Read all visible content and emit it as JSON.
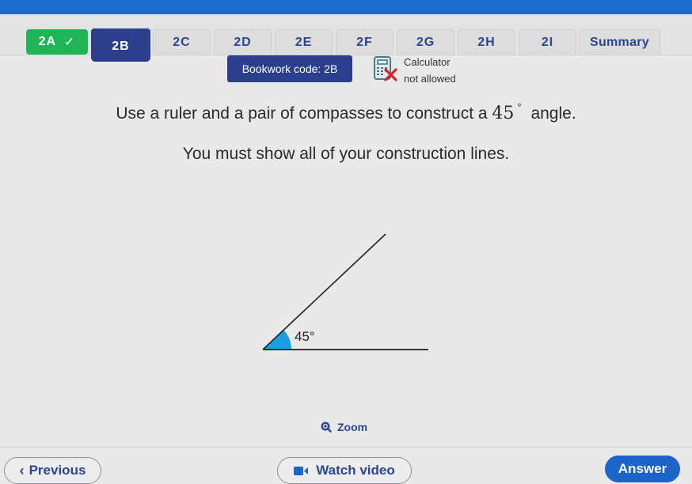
{
  "tabs": [
    {
      "label": "2A",
      "state": "done",
      "check_icon": "check-icon"
    },
    {
      "label": "2B",
      "state": "active"
    },
    {
      "label": "2C",
      "state": "default"
    },
    {
      "label": "2D",
      "state": "default"
    },
    {
      "label": "2E",
      "state": "default"
    },
    {
      "label": "2F",
      "state": "default"
    },
    {
      "label": "2G",
      "state": "default"
    },
    {
      "label": "2H",
      "state": "default"
    },
    {
      "label": "2I",
      "state": "default"
    },
    {
      "label": "Summary",
      "state": "default"
    }
  ],
  "header": {
    "bookwork_code": "Bookwork code: 2B",
    "calculator_line1": "Calculator",
    "calculator_line2": "not allowed",
    "calculator_icon": "calculator-not-allowed-icon"
  },
  "question": {
    "line1_before": "Use a ruler and a pair of compasses to construct a",
    "line1_number": "45",
    "line1_degree": "°",
    "line1_after": "angle.",
    "line2": "You must show all of your construction lines."
  },
  "diagram": {
    "angle_label": "45°",
    "angle_degrees": 45,
    "highlight_color": "#1b9fe0"
  },
  "footer": {
    "zoom_label": "Zoom",
    "previous_label": "Previous",
    "watch_video_label": "Watch video",
    "answer_label": "Answer"
  },
  "colors": {
    "brand_blue": "#1a67cc",
    "navy": "#2c3f8d",
    "success_green": "#1fb557",
    "answer_blue": "#1c64c8",
    "error_red": "#d9232d"
  }
}
